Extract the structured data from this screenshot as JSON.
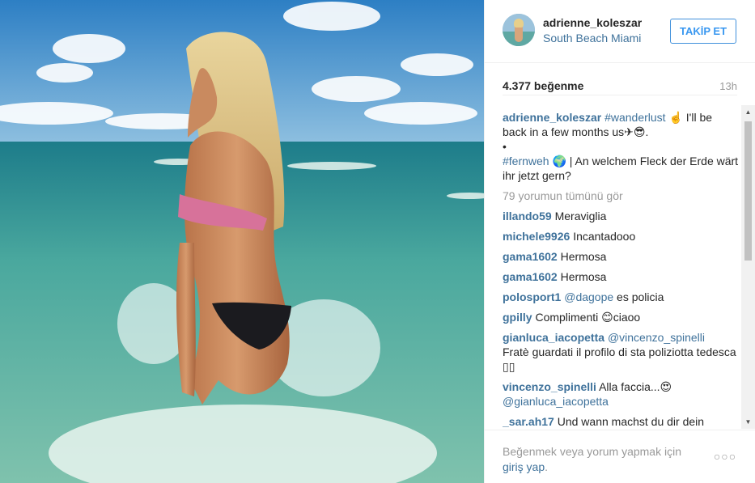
{
  "header": {
    "username": "adrienne_koleszar",
    "location": "South Beach Miami",
    "follow_label": "TAKİP ET"
  },
  "stats": {
    "likes": "4.377 beğenme",
    "time_ago": "13h"
  },
  "caption": {
    "username": "adrienne_koleszar",
    "hashtag1": "#wanderlust",
    "line1_rest": " ☝️ I'll be back in a few months us✈︎😎.",
    "bullet": "•",
    "hashtag2": "#fernweh",
    "line2_rest": " 🌍 | An welchem Fleck der Erde wärt ihr jetzt gern?"
  },
  "view_all_comments": "79 yorumun tümünü gör",
  "comments": [
    {
      "user": "illando59",
      "mention": "",
      "text": "Meraviglia"
    },
    {
      "user": "michele9926",
      "mention": "",
      "text": "Incantadooo"
    },
    {
      "user": "gama1602",
      "mention": "",
      "text": "Hermosa"
    },
    {
      "user": "gama1602",
      "mention": "",
      "text": "Hermosa"
    },
    {
      "user": "polosport1",
      "mention": "@dagope",
      "text": " es policia"
    },
    {
      "user": "gpilly",
      "mention": "",
      "text": "Complimenti 😊ciaoo"
    },
    {
      "user": "gianluca_iacopetta",
      "mention": "@vincenzo_spinelli",
      "text": "Fratè guardati il profilo di sta poliziotta tedesca ▯▯"
    },
    {
      "user": "vincenzo_spinelli",
      "mention": "",
      "text": "Alla faccia...😍",
      "mention_after": "@gianluca_iacopetta"
    },
    {
      "user": "_sar.ah17",
      "mention": "",
      "text": "Und wann machst du dir dein"
    }
  ],
  "footer": {
    "prompt": "Beğenmek veya yorum yapmak için ",
    "login_link": "giriş yap",
    "prompt_end": ".",
    "more_label": "○○○"
  },
  "colors": {
    "link": "#3f729b",
    "follow": "#3897f0",
    "muted": "#999999",
    "text": "#262626"
  },
  "icons": [
    "more-options-icon",
    "scroll-up-arrow-icon",
    "scroll-down-arrow-icon"
  ]
}
